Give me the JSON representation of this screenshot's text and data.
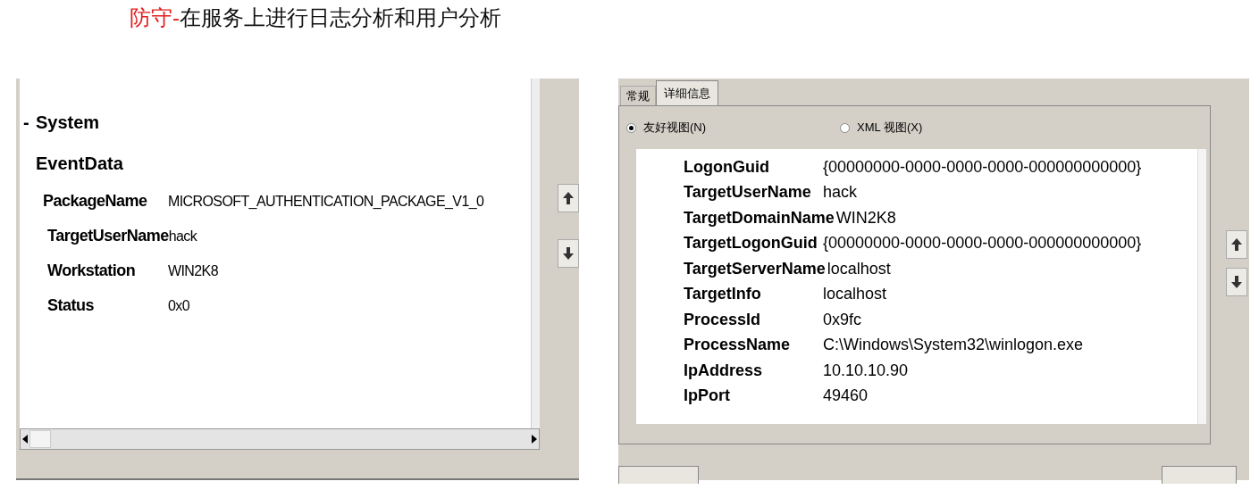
{
  "heading": {
    "highlight": "防守-",
    "text": "在服务上进行日志分析和用户分析"
  },
  "left_window": {
    "sections": [
      {
        "title": "System",
        "expander": "-"
      },
      {
        "title": "EventData"
      }
    ],
    "fields": [
      {
        "name": "PackageName",
        "value": "MICROSOFT_AUTHENTICATION_PACKAGE_V1_0"
      },
      {
        "name": "TargetUserName",
        "value": "hack"
      },
      {
        "name": "Workstation",
        "value": "WIN2K8"
      },
      {
        "name": "Status",
        "value": "0x0"
      }
    ]
  },
  "right_window": {
    "tabs": [
      {
        "label": "常规",
        "selected": false
      },
      {
        "label": "详细信息",
        "selected": true
      }
    ],
    "views": [
      {
        "label": "友好视图(N)",
        "selected": true
      },
      {
        "label": "XML 视图(X)",
        "selected": false
      }
    ],
    "fields": [
      {
        "name": "LogonGuid",
        "value": "{00000000-0000-0000-0000-000000000000}"
      },
      {
        "name": "TargetUserName",
        "value": "hack"
      },
      {
        "name": "TargetDomainName",
        "value": "WIN2K8"
      },
      {
        "name": "TargetLogonGuid",
        "value": "{00000000-0000-0000-0000-000000000000}"
      },
      {
        "name": "TargetServerName",
        "value": "localhost"
      },
      {
        "name": "TargetInfo",
        "value": "localhost"
      },
      {
        "name": "ProcessId",
        "value": "0x9fc"
      },
      {
        "name": "ProcessName",
        "value": "C:\\Windows\\System32\\winlogon.exe"
      },
      {
        "name": "IpAddress",
        "value": "10.10.10.90"
      },
      {
        "name": "IpPort",
        "value": "49460"
      }
    ]
  }
}
